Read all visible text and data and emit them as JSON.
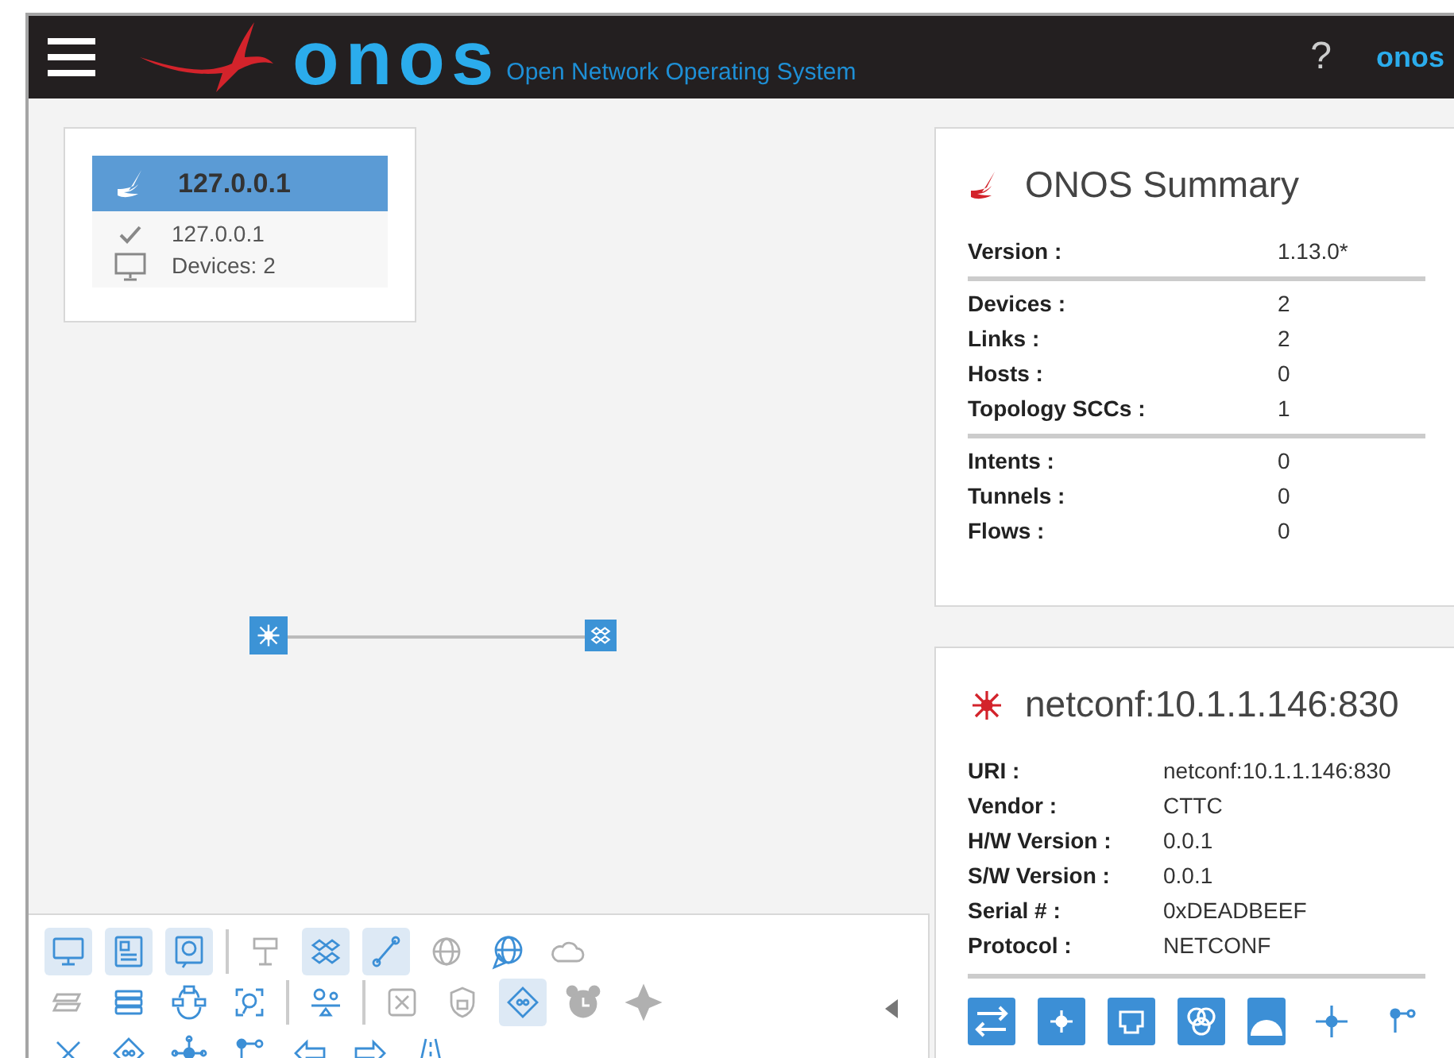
{
  "header": {
    "logo_text": "onos",
    "tagline": "Open Network Operating System",
    "help": "?",
    "user": "onos"
  },
  "instance": {
    "title": "127.0.0.1",
    "selected": true,
    "ready": true,
    "address": "127.0.0.1",
    "devices": "Devices: 2"
  },
  "summary": {
    "title": "ONOS Summary",
    "sections": [
      [
        {
          "label": "Version :",
          "value": "1.13.0*"
        }
      ],
      [
        {
          "label": "Devices :",
          "value": "2"
        },
        {
          "label": "Links :",
          "value": "2"
        },
        {
          "label": "Hosts :",
          "value": "0"
        },
        {
          "label": "Topology SCCs :",
          "value": "1"
        }
      ],
      [
        {
          "label": "Intents :",
          "value": "0"
        },
        {
          "label": "Tunnels :",
          "value": "0"
        },
        {
          "label": "Flows :",
          "value": "0"
        }
      ]
    ]
  },
  "device": {
    "title": "netconf:10.1.1.146:830",
    "props": [
      {
        "label": "URI :",
        "value": "netconf:10.1.1.146:830"
      },
      {
        "label": "Vendor :",
        "value": "CTTC"
      },
      {
        "label": "H/W Version :",
        "value": "0.0.1"
      },
      {
        "label": "S/W Version :",
        "value": "0.0.1"
      },
      {
        "label": "Serial # :",
        "value": "0xDEADBEEF"
      },
      {
        "label": "Protocol :",
        "value": "NETCONF"
      }
    ]
  },
  "toolbar": {
    "rows": [
      [
        {
          "kind": "button",
          "on": true,
          "disabled": false
        },
        {
          "kind": "button",
          "on": true,
          "disabled": false
        },
        {
          "kind": "button",
          "on": true,
          "disabled": false
        },
        {
          "kind": "separator"
        },
        {
          "kind": "button",
          "on": false,
          "disabled": true
        },
        {
          "kind": "button",
          "on": true,
          "disabled": false
        },
        {
          "kind": "button",
          "on": true,
          "disabled": false
        },
        {
          "kind": "button",
          "on": false,
          "disabled": true
        },
        {
          "kind": "button",
          "on": false,
          "disabled": false
        },
        {
          "kind": "button",
          "on": false,
          "disabled": true
        }
      ],
      [
        {
          "kind": "button",
          "on": false,
          "disabled": true
        },
        {
          "kind": "button",
          "on": false,
          "disabled": false
        },
        {
          "kind": "button",
          "on": false,
          "disabled": false
        },
        {
          "kind": "button",
          "on": false,
          "disabled": false
        },
        {
          "kind": "separator"
        },
        {
          "kind": "button",
          "on": false,
          "disabled": false
        },
        {
          "kind": "separator"
        },
        {
          "kind": "button",
          "on": false,
          "disabled": true
        },
        {
          "kind": "button",
          "on": false,
          "disabled": true
        },
        {
          "kind": "button",
          "on": true,
          "disabled": false
        },
        {
          "kind": "button",
          "on": false,
          "disabled": true
        },
        {
          "kind": "button",
          "on": false,
          "disabled": true
        }
      ],
      [
        {
          "kind": "button",
          "on": false,
          "disabled": false
        },
        {
          "kind": "button",
          "on": false,
          "disabled": false
        },
        {
          "kind": "button",
          "on": false,
          "disabled": false
        },
        {
          "kind": "button",
          "on": false,
          "disabled": false
        },
        {
          "kind": "button",
          "on": false,
          "disabled": false
        },
        {
          "kind": "button",
          "on": false,
          "disabled": false
        },
        {
          "kind": "button",
          "on": false,
          "disabled": false
        }
      ]
    ]
  }
}
